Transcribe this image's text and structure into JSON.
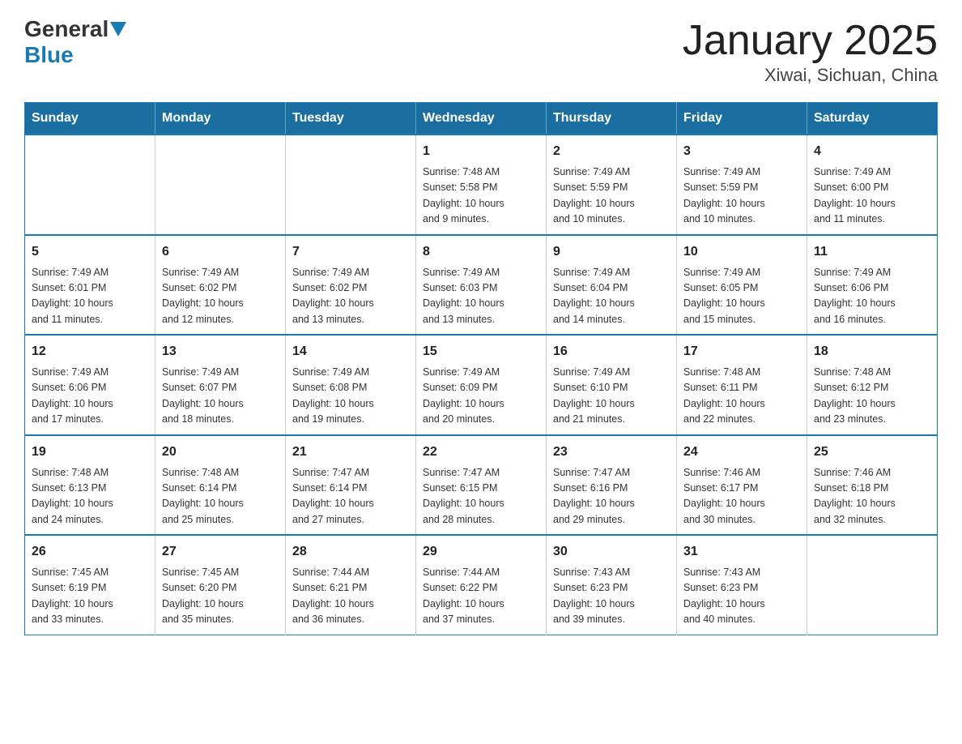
{
  "header": {
    "logo_general": "General",
    "logo_blue": "Blue",
    "title": "January 2025",
    "subtitle": "Xiwai, Sichuan, China"
  },
  "days_of_week": [
    "Sunday",
    "Monday",
    "Tuesday",
    "Wednesday",
    "Thursday",
    "Friday",
    "Saturday"
  ],
  "weeks": [
    [
      {
        "day": "",
        "info": ""
      },
      {
        "day": "",
        "info": ""
      },
      {
        "day": "",
        "info": ""
      },
      {
        "day": "1",
        "info": "Sunrise: 7:48 AM\nSunset: 5:58 PM\nDaylight: 10 hours\nand 9 minutes."
      },
      {
        "day": "2",
        "info": "Sunrise: 7:49 AM\nSunset: 5:59 PM\nDaylight: 10 hours\nand 10 minutes."
      },
      {
        "day": "3",
        "info": "Sunrise: 7:49 AM\nSunset: 5:59 PM\nDaylight: 10 hours\nand 10 minutes."
      },
      {
        "day": "4",
        "info": "Sunrise: 7:49 AM\nSunset: 6:00 PM\nDaylight: 10 hours\nand 11 minutes."
      }
    ],
    [
      {
        "day": "5",
        "info": "Sunrise: 7:49 AM\nSunset: 6:01 PM\nDaylight: 10 hours\nand 11 minutes."
      },
      {
        "day": "6",
        "info": "Sunrise: 7:49 AM\nSunset: 6:02 PM\nDaylight: 10 hours\nand 12 minutes."
      },
      {
        "day": "7",
        "info": "Sunrise: 7:49 AM\nSunset: 6:02 PM\nDaylight: 10 hours\nand 13 minutes."
      },
      {
        "day": "8",
        "info": "Sunrise: 7:49 AM\nSunset: 6:03 PM\nDaylight: 10 hours\nand 13 minutes."
      },
      {
        "day": "9",
        "info": "Sunrise: 7:49 AM\nSunset: 6:04 PM\nDaylight: 10 hours\nand 14 minutes."
      },
      {
        "day": "10",
        "info": "Sunrise: 7:49 AM\nSunset: 6:05 PM\nDaylight: 10 hours\nand 15 minutes."
      },
      {
        "day": "11",
        "info": "Sunrise: 7:49 AM\nSunset: 6:06 PM\nDaylight: 10 hours\nand 16 minutes."
      }
    ],
    [
      {
        "day": "12",
        "info": "Sunrise: 7:49 AM\nSunset: 6:06 PM\nDaylight: 10 hours\nand 17 minutes."
      },
      {
        "day": "13",
        "info": "Sunrise: 7:49 AM\nSunset: 6:07 PM\nDaylight: 10 hours\nand 18 minutes."
      },
      {
        "day": "14",
        "info": "Sunrise: 7:49 AM\nSunset: 6:08 PM\nDaylight: 10 hours\nand 19 minutes."
      },
      {
        "day": "15",
        "info": "Sunrise: 7:49 AM\nSunset: 6:09 PM\nDaylight: 10 hours\nand 20 minutes."
      },
      {
        "day": "16",
        "info": "Sunrise: 7:49 AM\nSunset: 6:10 PM\nDaylight: 10 hours\nand 21 minutes."
      },
      {
        "day": "17",
        "info": "Sunrise: 7:48 AM\nSunset: 6:11 PM\nDaylight: 10 hours\nand 22 minutes."
      },
      {
        "day": "18",
        "info": "Sunrise: 7:48 AM\nSunset: 6:12 PM\nDaylight: 10 hours\nand 23 minutes."
      }
    ],
    [
      {
        "day": "19",
        "info": "Sunrise: 7:48 AM\nSunset: 6:13 PM\nDaylight: 10 hours\nand 24 minutes."
      },
      {
        "day": "20",
        "info": "Sunrise: 7:48 AM\nSunset: 6:14 PM\nDaylight: 10 hours\nand 25 minutes."
      },
      {
        "day": "21",
        "info": "Sunrise: 7:47 AM\nSunset: 6:14 PM\nDaylight: 10 hours\nand 27 minutes."
      },
      {
        "day": "22",
        "info": "Sunrise: 7:47 AM\nSunset: 6:15 PM\nDaylight: 10 hours\nand 28 minutes."
      },
      {
        "day": "23",
        "info": "Sunrise: 7:47 AM\nSunset: 6:16 PM\nDaylight: 10 hours\nand 29 minutes."
      },
      {
        "day": "24",
        "info": "Sunrise: 7:46 AM\nSunset: 6:17 PM\nDaylight: 10 hours\nand 30 minutes."
      },
      {
        "day": "25",
        "info": "Sunrise: 7:46 AM\nSunset: 6:18 PM\nDaylight: 10 hours\nand 32 minutes."
      }
    ],
    [
      {
        "day": "26",
        "info": "Sunrise: 7:45 AM\nSunset: 6:19 PM\nDaylight: 10 hours\nand 33 minutes."
      },
      {
        "day": "27",
        "info": "Sunrise: 7:45 AM\nSunset: 6:20 PM\nDaylight: 10 hours\nand 35 minutes."
      },
      {
        "day": "28",
        "info": "Sunrise: 7:44 AM\nSunset: 6:21 PM\nDaylight: 10 hours\nand 36 minutes."
      },
      {
        "day": "29",
        "info": "Sunrise: 7:44 AM\nSunset: 6:22 PM\nDaylight: 10 hours\nand 37 minutes."
      },
      {
        "day": "30",
        "info": "Sunrise: 7:43 AM\nSunset: 6:23 PM\nDaylight: 10 hours\nand 39 minutes."
      },
      {
        "day": "31",
        "info": "Sunrise: 7:43 AM\nSunset: 6:23 PM\nDaylight: 10 hours\nand 40 minutes."
      },
      {
        "day": "",
        "info": ""
      }
    ]
  ]
}
